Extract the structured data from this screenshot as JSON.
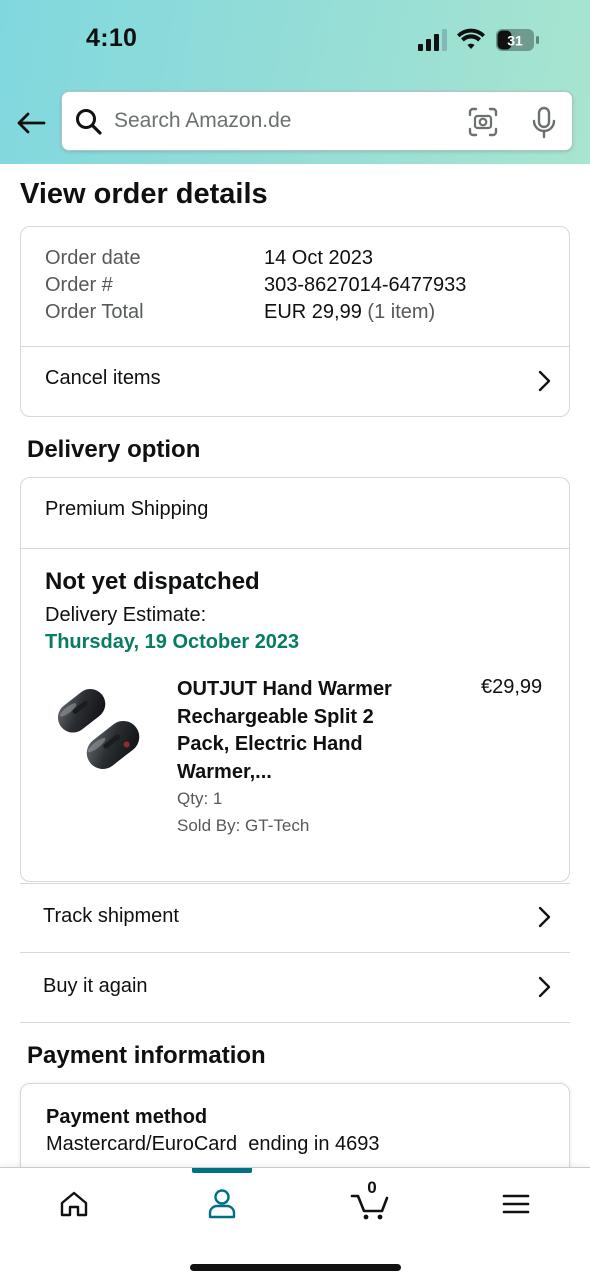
{
  "status_bar": {
    "time": "4:10",
    "battery": "31"
  },
  "search": {
    "placeholder": "Search Amazon.de"
  },
  "page_title": "View order details",
  "order_summary": {
    "date_label": "Order date",
    "date_value": "14 Oct 2023",
    "number_label": "Order #",
    "number_value": "303-8627014-6477933",
    "total_label": "Order Total",
    "total_value": "EUR 29,99",
    "total_items": "(1 item)",
    "cancel_label": "Cancel items"
  },
  "delivery": {
    "section_title": "Delivery option",
    "shipping_type": "Premium Shipping",
    "status": "Not yet dispatched",
    "estimate_label": "Delivery Estimate:",
    "estimate_date": "Thursday, 19 October 2023",
    "estimate_color": "#067d62",
    "product": {
      "title": "OUTJUT Hand Warmer Rechargeable Split 2 Pack, Electric Hand Warmer,...",
      "price": "€29,99",
      "qty": "Qty: 1",
      "seller": "Sold By: GT-Tech"
    }
  },
  "actions": {
    "track": "Track shipment",
    "buy_again": "Buy it again"
  },
  "payment": {
    "section_title": "Payment information",
    "method_title": "Payment method",
    "method_detail": "Mastercard/EuroCard  ending in 4693"
  },
  "bottom_nav": {
    "active": "account",
    "active_color": "#007185",
    "cart_count": "0"
  }
}
